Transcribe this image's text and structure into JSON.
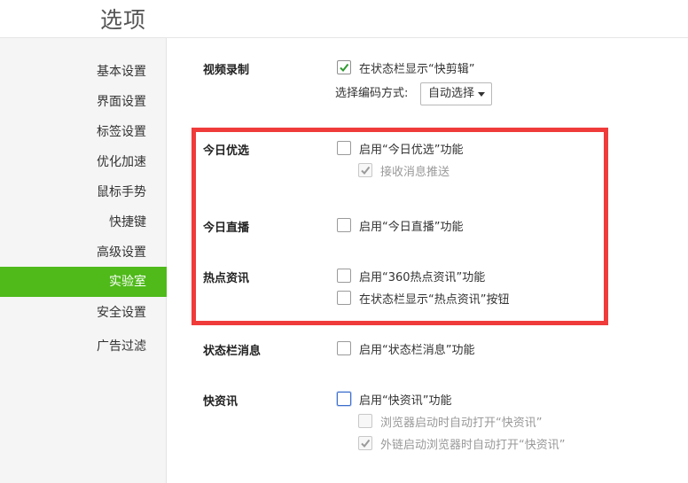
{
  "header": {
    "title": "选项"
  },
  "sidebar": {
    "items": [
      {
        "label": "基本设置",
        "active": false
      },
      {
        "label": "界面设置",
        "active": false
      },
      {
        "label": "标签设置",
        "active": false
      },
      {
        "label": "优化加速",
        "active": false
      },
      {
        "label": "鼠标手势",
        "active": false
      },
      {
        "label": "快捷键",
        "active": false
      },
      {
        "label": "高级设置",
        "active": false
      },
      {
        "label": "实验室",
        "active": true
      },
      {
        "label": "安全设置",
        "active": false
      },
      {
        "label": "广告过滤",
        "active": false
      }
    ]
  },
  "sections": {
    "video_record": {
      "title": "视频录制",
      "show_statusbar": {
        "label": "在状态栏显示“快剪辑”",
        "checked": true
      },
      "codec_label": "选择编码方式:",
      "codec_value": "自动选择"
    },
    "today_pick": {
      "title": "今日优选",
      "enable": {
        "label": "启用“今日优选”功能",
        "checked": false
      },
      "push": {
        "label": "接收消息推送",
        "checked": true,
        "disabled": true
      }
    },
    "today_live": {
      "title": "今日直播",
      "enable": {
        "label": "启用“今日直播”功能",
        "checked": false
      }
    },
    "hot_news": {
      "title": "热点资讯",
      "enable": {
        "label": "启用“360热点资讯”功能",
        "checked": false
      },
      "statusbar_button": {
        "label": "在状态栏显示“热点资讯”按钮",
        "checked": false
      }
    },
    "statusbar_msg": {
      "title": "状态栏消息",
      "enable": {
        "label": "启用“状态栏消息”功能",
        "checked": false
      }
    },
    "quick_news": {
      "title": "快资讯",
      "enable": {
        "label": "启用“快资讯”功能",
        "checked": false
      },
      "open_on_start": {
        "label": "浏览器启动时自动打开“快资讯”",
        "checked": false,
        "disabled": true
      },
      "open_on_external": {
        "label": "外链启动浏览器时自动打开“快资讯”",
        "checked": true,
        "disabled": true
      }
    }
  },
  "colors": {
    "accent": "#4fba1a",
    "highlight": "#f03b3b",
    "focus": "#3c6dcc"
  }
}
